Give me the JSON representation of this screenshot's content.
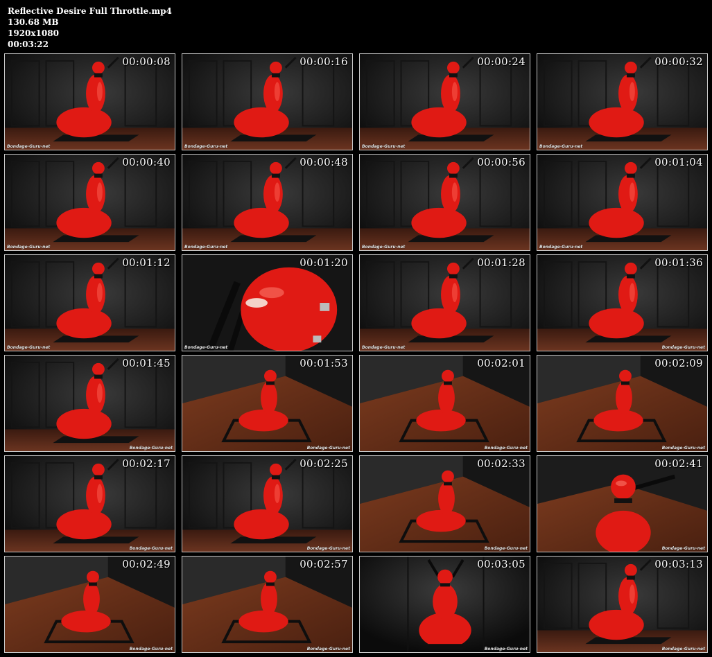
{
  "file": {
    "name": "Reflective Desire Full Throttle.mp4",
    "size": "130.68 MB",
    "resolution": "1920x1080",
    "duration": "00:03:22"
  },
  "watermark": "Bondage-Guru-net",
  "colors": {
    "background": "#000000",
    "latex_red": "#e01a14",
    "wall": "#262626",
    "floor": "#5a2a18"
  },
  "thumbnails": [
    {
      "time": "00:00:08",
      "scene": "wall",
      "watermark_side": "left"
    },
    {
      "time": "00:00:16",
      "scene": "wall",
      "watermark_side": "left"
    },
    {
      "time": "00:00:24",
      "scene": "wall",
      "watermark_side": "left"
    },
    {
      "time": "00:00:32",
      "scene": "wall",
      "watermark_side": "left"
    },
    {
      "time": "00:00:40",
      "scene": "wall",
      "watermark_side": "left"
    },
    {
      "time": "00:00:48",
      "scene": "wall",
      "watermark_side": "left"
    },
    {
      "time": "00:00:56",
      "scene": "wall",
      "watermark_side": "left"
    },
    {
      "time": "00:01:04",
      "scene": "wall",
      "watermark_side": "left"
    },
    {
      "time": "00:01:12",
      "scene": "wall",
      "watermark_side": "left"
    },
    {
      "time": "00:01:20",
      "scene": "closeup",
      "watermark_side": "left"
    },
    {
      "time": "00:01:28",
      "scene": "wall",
      "watermark_side": "left"
    },
    {
      "time": "00:01:36",
      "scene": "wall",
      "watermark_side": "right"
    },
    {
      "time": "00:01:45",
      "scene": "wall",
      "watermark_side": "right"
    },
    {
      "time": "00:01:53",
      "scene": "corner",
      "watermark_side": "right"
    },
    {
      "time": "00:02:01",
      "scene": "corner",
      "watermark_side": "right"
    },
    {
      "time": "00:02:09",
      "scene": "corner",
      "watermark_side": "right"
    },
    {
      "time": "00:02:17",
      "scene": "wall",
      "watermark_side": "right"
    },
    {
      "time": "00:02:25",
      "scene": "wall",
      "watermark_side": "right"
    },
    {
      "time": "00:02:33",
      "scene": "corner",
      "watermark_side": "right"
    },
    {
      "time": "00:02:41",
      "scene": "upper",
      "watermark_side": "right"
    },
    {
      "time": "00:02:49",
      "scene": "corner",
      "watermark_side": "right"
    },
    {
      "time": "00:02:57",
      "scene": "corner",
      "watermark_side": "right"
    },
    {
      "time": "00:03:05",
      "scene": "front",
      "watermark_side": "right"
    },
    {
      "time": "00:03:13",
      "scene": "wall",
      "watermark_side": "right"
    }
  ]
}
